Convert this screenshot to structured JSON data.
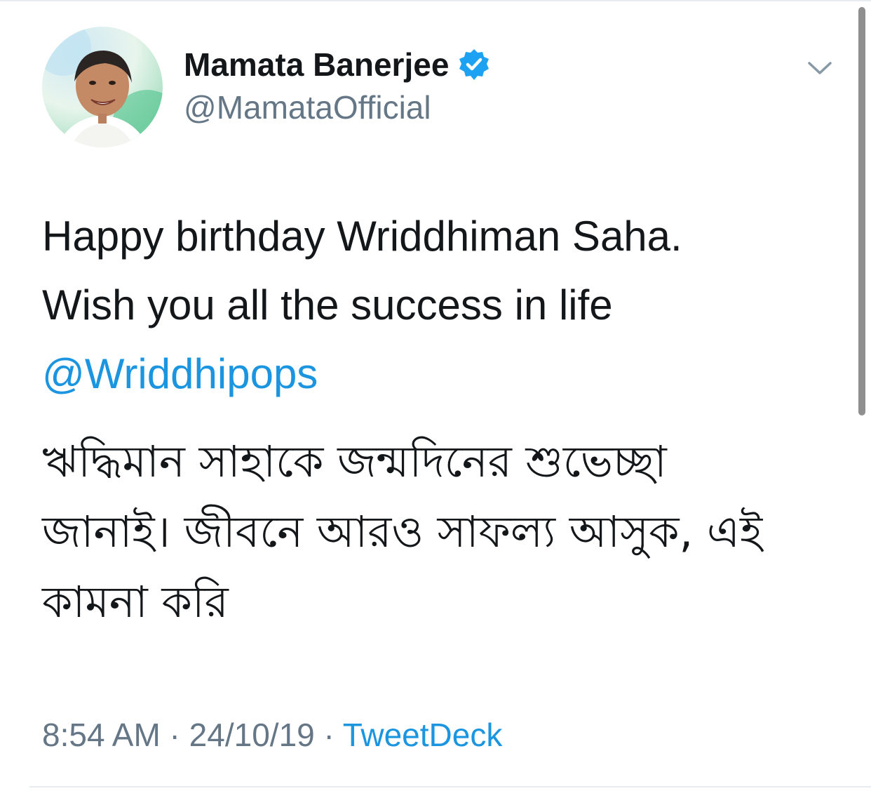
{
  "tweet": {
    "author": {
      "display_name": "Mamata Banerjee",
      "handle": "@MamataOfficial",
      "verified_icon": "verified-badge-icon"
    },
    "text_lines": [
      "Happy birthday Wriddhiman Saha.",
      "Wish you all the success in life"
    ],
    "mention": "@Wriddhipops",
    "bengali_lines": [
      "ঋদ্ধিমান সাহাকে জন্মদিনের শুভেচ্ছা",
      "জানাই। জীবনে আরও সাফল্য আসুক, এই",
      "কামনা করি"
    ],
    "meta": {
      "time": "8:54 AM",
      "separator1": " · ",
      "date": "24/10/19",
      "separator2": " · ",
      "source": "TweetDeck"
    }
  },
  "icons": {
    "caret": "chevron-down-icon"
  },
  "colors": {
    "link": "#1b95e0",
    "secondary_text": "#657786",
    "primary_text": "#14171a",
    "divider": "#e6ecf0"
  }
}
